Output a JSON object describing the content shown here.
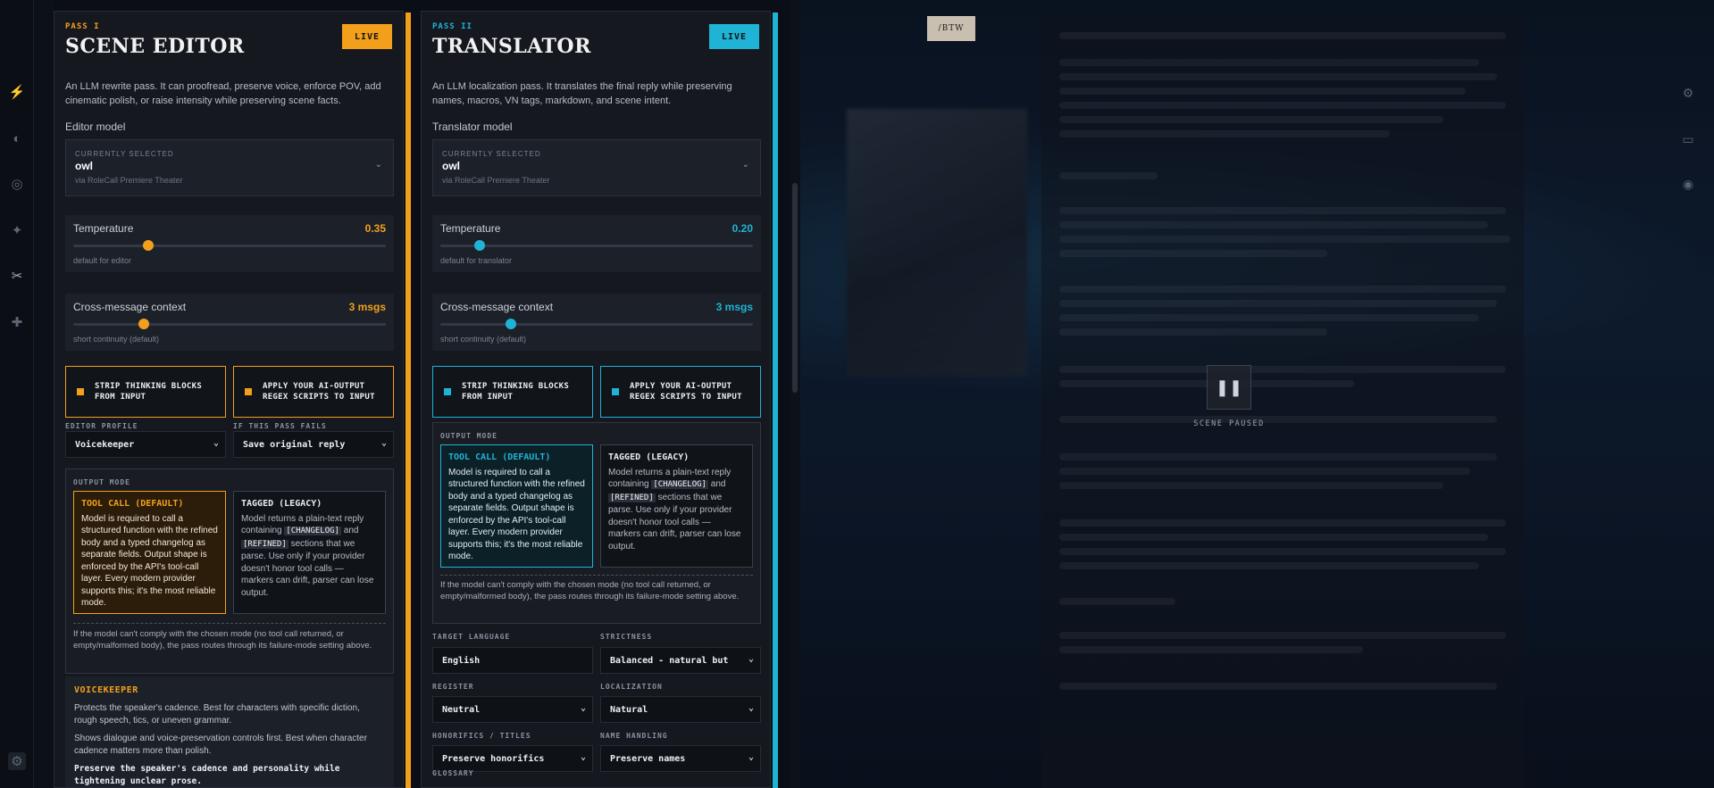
{
  "rail": {
    "items": [
      {
        "name": "bolt-icon",
        "glyph": "⚡",
        "active": false
      },
      {
        "name": "palette-icon",
        "glyph": "◐",
        "active": false
      },
      {
        "name": "compass-icon",
        "glyph": "◎",
        "active": false
      },
      {
        "name": "magic-wand-icon",
        "glyph": "✦",
        "active": false
      },
      {
        "name": "scissors-icon",
        "glyph": "✂",
        "active": true
      },
      {
        "name": "puzzle-icon",
        "glyph": "✚",
        "active": false
      }
    ],
    "bottom_icon": "bug-icon"
  },
  "editor": {
    "pass": "PASS I",
    "title": "SCENE EDITOR",
    "live": "LIVE",
    "accent": "#f2a01c",
    "description": "An LLM rewrite pass. It can proofread, preserve voice, enforce POV, add cinematic polish, or raise intensity while preserving scene facts.",
    "model_label": "Editor model",
    "model": {
      "small": "CURRENTLY SELECTED",
      "value": "owl",
      "via": "via RoleCall Premiere Theater"
    },
    "temperature": {
      "label": "Temperature",
      "value": "0.35",
      "level": 0.35,
      "hint": "default for editor"
    },
    "context": {
      "label": "Cross-message context",
      "value": "3 msgs",
      "level": 0.23,
      "hint": "short continuity (default)"
    },
    "toggles": [
      "STRIP THINKING BLOCKS FROM INPUT",
      "APPLY YOUR AI-OUTPUT REGEX SCRIPTS TO INPUT"
    ],
    "profile_label": "EDITOR PROFILE",
    "profile_value": "Voicekeeper",
    "fail_label": "IF THIS PASS FAILS",
    "fail_value": "Save original reply",
    "output_mode_label": "OUTPUT MODE",
    "fail_note": "If the model can't comply with the chosen mode (no tool call returned, or empty/malformed body), the pass routes through its failure-mode setting above.",
    "voicekeeper": {
      "title": "VOICEKEEPER",
      "p1": "Protects the speaker's cadence. Best for characters with specific diction, rough speech, tics, or uneven grammar.",
      "p2": "Shows dialogue and voice-preservation controls first. Best when character cadence matters more than polish.",
      "p3": "Preserve the speaker's cadence and personality while tightening unclear prose."
    }
  },
  "translator": {
    "pass": "PASS II",
    "title": "TRANSLATOR",
    "live": "LIVE",
    "accent": "#1fb3d6",
    "description": "An LLM localization pass. It translates the final reply while preserving names, macros, VN tags, markdown, and scene intent.",
    "model_label": "Translator model",
    "model": {
      "small": "CURRENTLY SELECTED",
      "value": "owl",
      "via": "via RoleCall Premiere Theater"
    },
    "temperature": {
      "label": "Temperature",
      "value": "0.20",
      "level": 0.12,
      "hint": "default for translator"
    },
    "context": {
      "label": "Cross-message context",
      "value": "3 msgs",
      "level": 0.23,
      "hint": "short continuity (default)"
    },
    "toggles": [
      "STRIP THINKING BLOCKS FROM INPUT",
      "APPLY YOUR AI-OUTPUT REGEX SCRIPTS TO INPUT"
    ],
    "output_mode_label": "OUTPUT MODE",
    "fail_note": "If the model can't comply with the chosen mode (no tool call returned, or empty/malformed body), the pass routes through its failure-mode setting above.",
    "fields": {
      "target_language_label": "TARGET LANGUAGE",
      "target_language": "English",
      "strictness_label": "STRICTNESS",
      "strictness": "Balanced - natural but",
      "register_label": "REGISTER",
      "register": "Neutral",
      "localization_label": "LOCALIZATION",
      "localization": "Natural",
      "honorifics_label": "HONORIFICS / TITLES",
      "honorifics": "Preserve honorifics",
      "name_handling_label": "NAME HANDLING",
      "name_handling": "Preserve names",
      "glossary_label": "GLOSSARY"
    }
  },
  "modes": {
    "tool_title": "TOOL CALL (DEFAULT)",
    "tool_body": "Model is required to call a structured function with the refined body and a typed changelog as separate fields. Output shape is enforced by the API's tool-call layer. Every modern provider supports this; it's the most reliable mode.",
    "tagged_title": "TAGGED (LEGACY)",
    "tagged_pre": "Model returns a plain-text reply containing",
    "tagged_code1": "[CHANGELOG]",
    "tagged_and": "and",
    "tagged_code2": "[REFINED]",
    "tagged_post": "sections that we parse. Use only if your provider doesn't honor tool calls — markers can drift, parser can lose output."
  },
  "scene": {
    "badge": "/BTW",
    "paused": "SCENE PAUSED",
    "right_icons": [
      "gear-icon",
      "monitor-icon",
      "eye-icon"
    ]
  }
}
